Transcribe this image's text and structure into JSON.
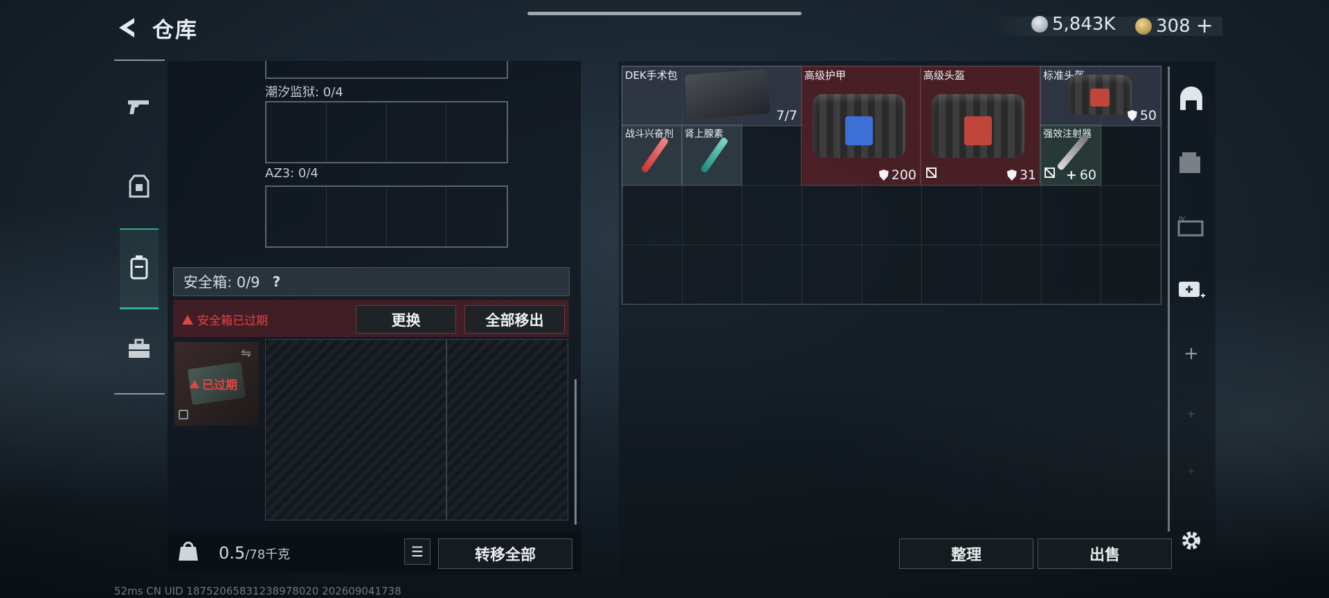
{
  "header": {
    "title": "仓库"
  },
  "currency": {
    "silver": "5,843K",
    "gold": "308"
  },
  "left": {
    "slots": [
      {
        "label": "潮汐监狱: 0/4"
      },
      {
        "label": "AZ3: 0/4"
      }
    ],
    "safe_box": {
      "title": "安全箱:  0/9",
      "help": "?",
      "warning": "安全箱已过期",
      "replace_label": "更换",
      "remove_all_label": "全部移出",
      "expired_tag": "已过期"
    },
    "bottom": {
      "weight_current": "0.5",
      "weight_max": "/78千克",
      "transfer_all_label": "转移全部"
    }
  },
  "stash": {
    "items": [
      {
        "name": "DEK手术包",
        "value": "7/7"
      },
      {
        "name": "高级护甲",
        "value": "200"
      },
      {
        "name": "高级头盔",
        "value": "31"
      },
      {
        "name": "标准头盔",
        "value": "50"
      },
      {
        "name": "战斗兴奋剂",
        "value": ""
      },
      {
        "name": "肾上腺素",
        "value": ""
      },
      {
        "name": "强效注射器",
        "value": "60"
      }
    ],
    "organize_label": "整理",
    "sell_label": "出售"
  },
  "footer": {
    "status": "52ms        CN UID 18752065831238978020  202609041738"
  },
  "colors": {
    "accent": "#2fae90",
    "danger": "#e04545",
    "armor_bg": "#5a2328"
  }
}
